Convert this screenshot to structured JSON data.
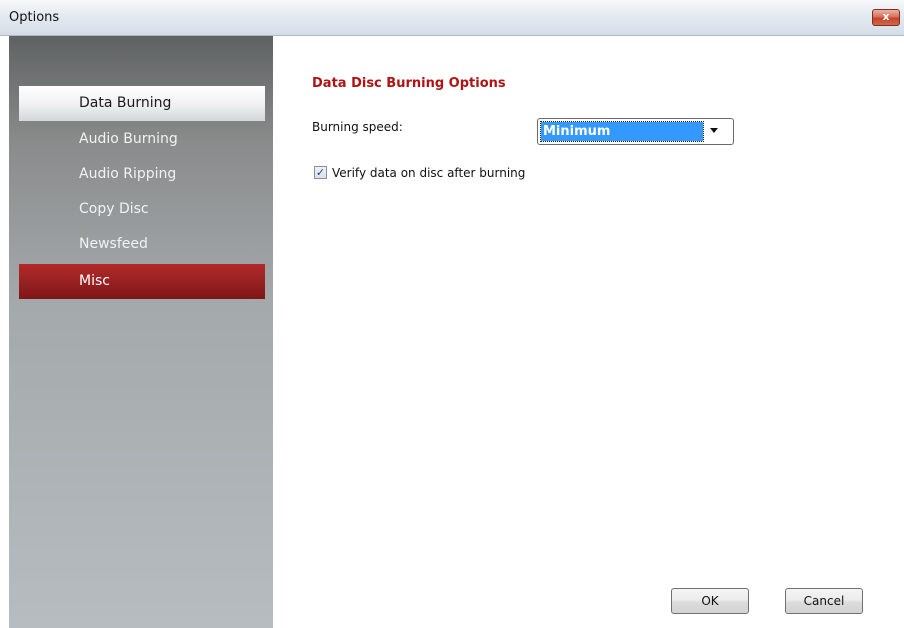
{
  "window": {
    "title": "Options",
    "close_glyph": "x"
  },
  "sidebar": {
    "items": [
      {
        "label": "Data Burning",
        "state": "selected"
      },
      {
        "label": "Audio Burning",
        "state": "normal"
      },
      {
        "label": "Audio Ripping",
        "state": "normal"
      },
      {
        "label": "Copy Disc",
        "state": "normal"
      },
      {
        "label": "Newsfeed",
        "state": "normal"
      },
      {
        "label": "Misc",
        "state": "highlighted"
      }
    ]
  },
  "main": {
    "section_title": "Data Disc Burning Options",
    "burning_speed": {
      "label": "Burning speed:",
      "selected_value": "Minimum"
    },
    "verify": {
      "label": "Verify data on disc after burning",
      "checked": true,
      "check_glyph": "✓"
    }
  },
  "footer": {
    "ok_label": "OK",
    "cancel_label": "Cancel"
  },
  "colors": {
    "section_title": "#b01313",
    "highlight_red": "#962020",
    "selection_blue": "#3399ff"
  }
}
